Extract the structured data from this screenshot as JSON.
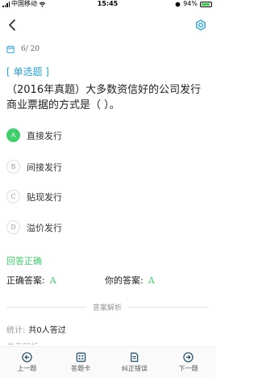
{
  "status_bar": {
    "carrier": "中国移动",
    "time": "15:45",
    "battery": "94%"
  },
  "question": {
    "progress": "6/ 20",
    "type": "[ 单选题 ]",
    "text": "（2016年真题）大多数资信好的公司发行商业票据的方式是（ ）。",
    "options": [
      {
        "letter": "A",
        "text": "直接发行",
        "correct": true
      },
      {
        "letter": "B",
        "text": "间接发行",
        "correct": false
      },
      {
        "letter": "C",
        "text": "贴现发行",
        "correct": false
      },
      {
        "letter": "D",
        "text": "溢价发行",
        "correct": false
      }
    ]
  },
  "result": {
    "status": "回答正确",
    "correct_label": "正确答案:",
    "correct_value": "A",
    "your_label": "你的答案:",
    "your_value": "A"
  },
  "analysis": {
    "header": "答案解析",
    "stats_label": "统计:",
    "stats_value": "共0人答过",
    "ref_label": "参考解析"
  },
  "bottom_nav": {
    "prev": "上一题",
    "card": "答题卡",
    "report": "纠正错误",
    "next": "下一题"
  },
  "colors": {
    "accent_blue": "#2aa4d8",
    "correct_green": "#3fcf6a"
  }
}
